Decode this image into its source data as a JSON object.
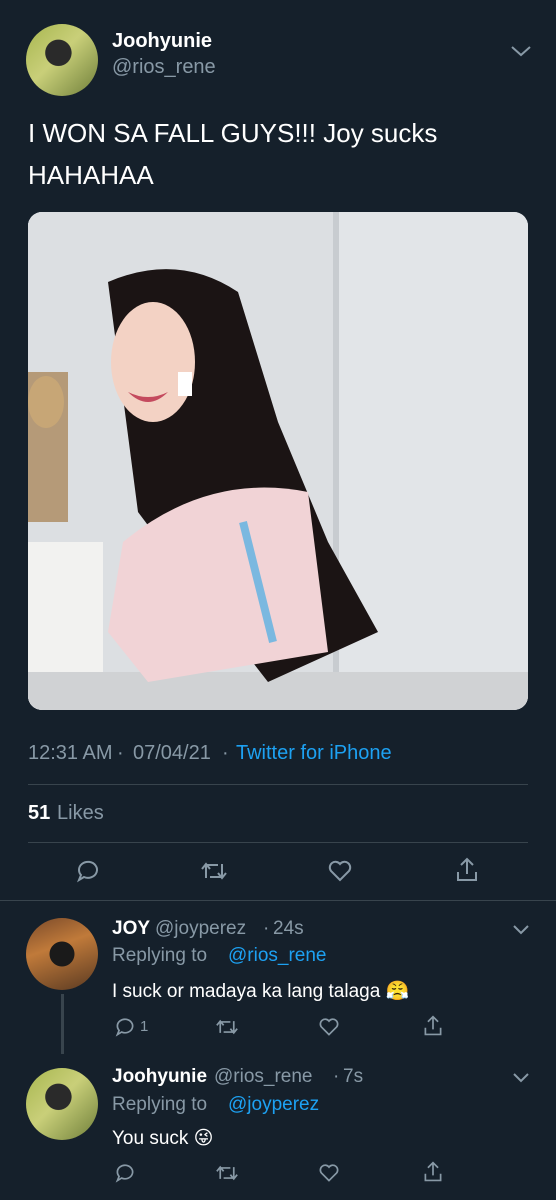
{
  "tweet": {
    "display_name": "Joohyunie",
    "handle": "@rios_rene",
    "text_line1": "I WON SA FALL GUYS!!! Joy sucks",
    "text_line2": "HAHAHAA",
    "time": "12:31 AM",
    "sep1": "·",
    "date": "07/04/21",
    "sep2": "·",
    "source": "Twitter for iPhone",
    "likes_count": "51",
    "likes_label": "Likes"
  },
  "replies": [
    {
      "display_name": "JOY",
      "handle": "@joyperez",
      "dot": "·",
      "time": "24s",
      "replying_prefix": "Replying to",
      "replying_to": "@rios_rene",
      "text": "I suck or madaya ka lang talaga 😤",
      "reply_count": "1"
    },
    {
      "display_name": "Joohyunie",
      "handle": "@rios_rene",
      "dot": "·",
      "time": "7s",
      "replying_prefix": "Replying to",
      "replying_to": "@joyperez",
      "text": "You suck 😜"
    }
  ],
  "icons": {
    "reply": "reply-icon",
    "retweet": "retweet-icon",
    "like": "heart-icon",
    "share": "share-icon",
    "more": "chevron-down-icon"
  },
  "colors": {
    "background": "#15202b",
    "link": "#1da1f2",
    "muted": "#8899a6",
    "divider": "#38444d"
  }
}
